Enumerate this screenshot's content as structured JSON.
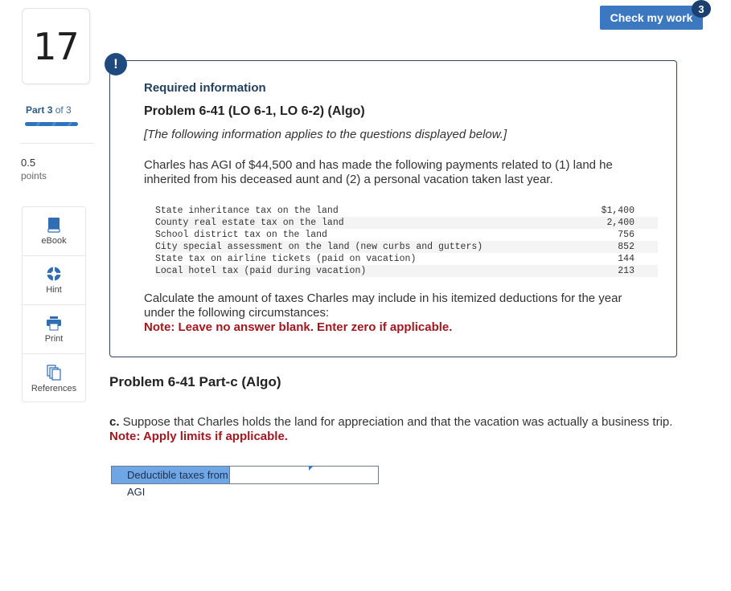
{
  "sidebar": {
    "question_number": "17",
    "part_word": "Part",
    "part_current": "3",
    "part_of": "of 3",
    "part_progress": 1.0,
    "points_value": "0.5",
    "points_label": "points",
    "tools": [
      {
        "label": "eBook",
        "icon": "book-icon"
      },
      {
        "label": "Hint",
        "icon": "lifebuoy-icon"
      },
      {
        "label": "Print",
        "icon": "printer-icon"
      },
      {
        "label": "References",
        "icon": "documents-icon"
      }
    ]
  },
  "header": {
    "check_label": "Check my work",
    "check_badge": "3"
  },
  "required_info": {
    "alert_glyph": "!",
    "title": "Required information",
    "problem_title": "Problem 6-41 (LO 6-1, LO 6-2) (Algo)",
    "applies_note": "[The following information applies to the questions displayed below.]",
    "intro": "Charles has AGI of $44,500 and has made the following payments related to (1) land he inherited from his deceased aunt and (2) a personal vacation taken last year.",
    "taxes": [
      {
        "item": "State inheritance tax on the land",
        "amount": "$1,400"
      },
      {
        "item": "County real estate tax on the land",
        "amount": "2,400"
      },
      {
        "item": "School district tax on the land",
        "amount": "756"
      },
      {
        "item": "City special assessment on the land (new curbs and gutters)",
        "amount": "852"
      },
      {
        "item": "State tax on airline tickets (paid on vacation)",
        "amount": "144"
      },
      {
        "item": "Local hotel tax (paid during vacation)",
        "amount": "213"
      }
    ],
    "calc_text": "Calculate the amount of taxes Charles may include in his itemized deductions for the year under the following circumstances:",
    "note": "Note: Leave no answer blank. Enter zero if applicable."
  },
  "part_c": {
    "title": "Problem 6-41 Part-c (Algo)",
    "prefix": "c.",
    "question": " Suppose that Charles holds the land for appreciation and that the vacation was actually a business trip.",
    "note": "Note: Apply limits if applicable.",
    "answer_label": "Deductible taxes from AGI",
    "answer_value": ""
  }
}
